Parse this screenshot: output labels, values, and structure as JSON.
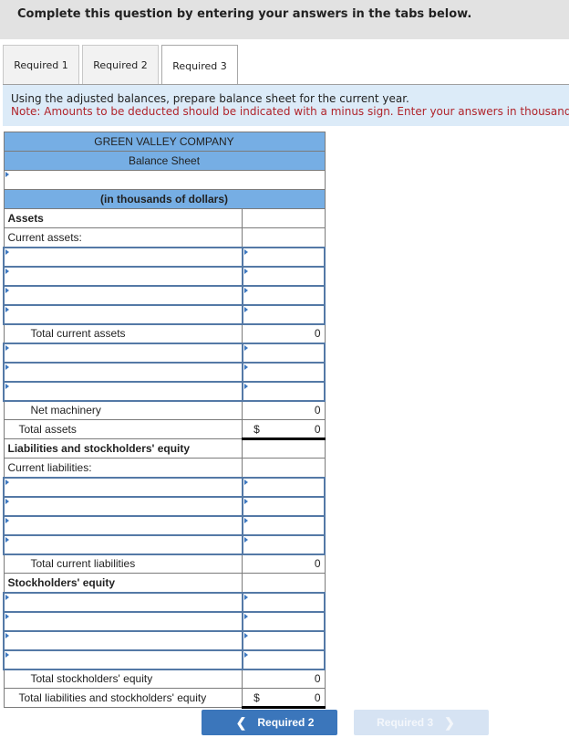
{
  "banner": {
    "text": "Complete this question by entering your answers in the tabs below."
  },
  "tabs": [
    {
      "label": "Required 1",
      "active": false
    },
    {
      "label": "Required 2",
      "active": false
    },
    {
      "label": "Required 3",
      "active": true
    }
  ],
  "instructions": {
    "line1": "Using the adjusted balances, prepare balance sheet for the current year.",
    "note": "Note: Amounts to be deducted should be indicated with a minus sign. Enter your answers in thousands."
  },
  "balance_sheet": {
    "company": "GREEN VALLEY COMPANY",
    "title": "Balance Sheet",
    "date_input": "",
    "units": "(in thousands of dollars)",
    "assets_heading": "Assets",
    "current_assets_label": "Current assets:",
    "total_current_assets": {
      "label": "Total current assets",
      "value": "0"
    },
    "net_machinery": {
      "label": "Net machinery",
      "value": "0"
    },
    "total_assets": {
      "label": "Total assets",
      "currency": "$",
      "value": "0"
    },
    "liab_heading": "Liabilities and stockholders' equity",
    "current_liabilities_label": "Current liabilities:",
    "total_current_liabilities": {
      "label": "Total current liabilities",
      "value": "0"
    },
    "equity_heading": "Stockholders' equity",
    "total_equity": {
      "label": "Total stockholders' equity",
      "value": "0"
    },
    "total_liab_equity": {
      "label": "Total liabilities and stockholders' equity",
      "currency": "$",
      "value": "0"
    }
  },
  "nav": {
    "prev_label": "Required 2",
    "next_label": "Required 3",
    "prev_icon": "chevron-left-icon",
    "next_icon": "chevron-right-icon"
  }
}
